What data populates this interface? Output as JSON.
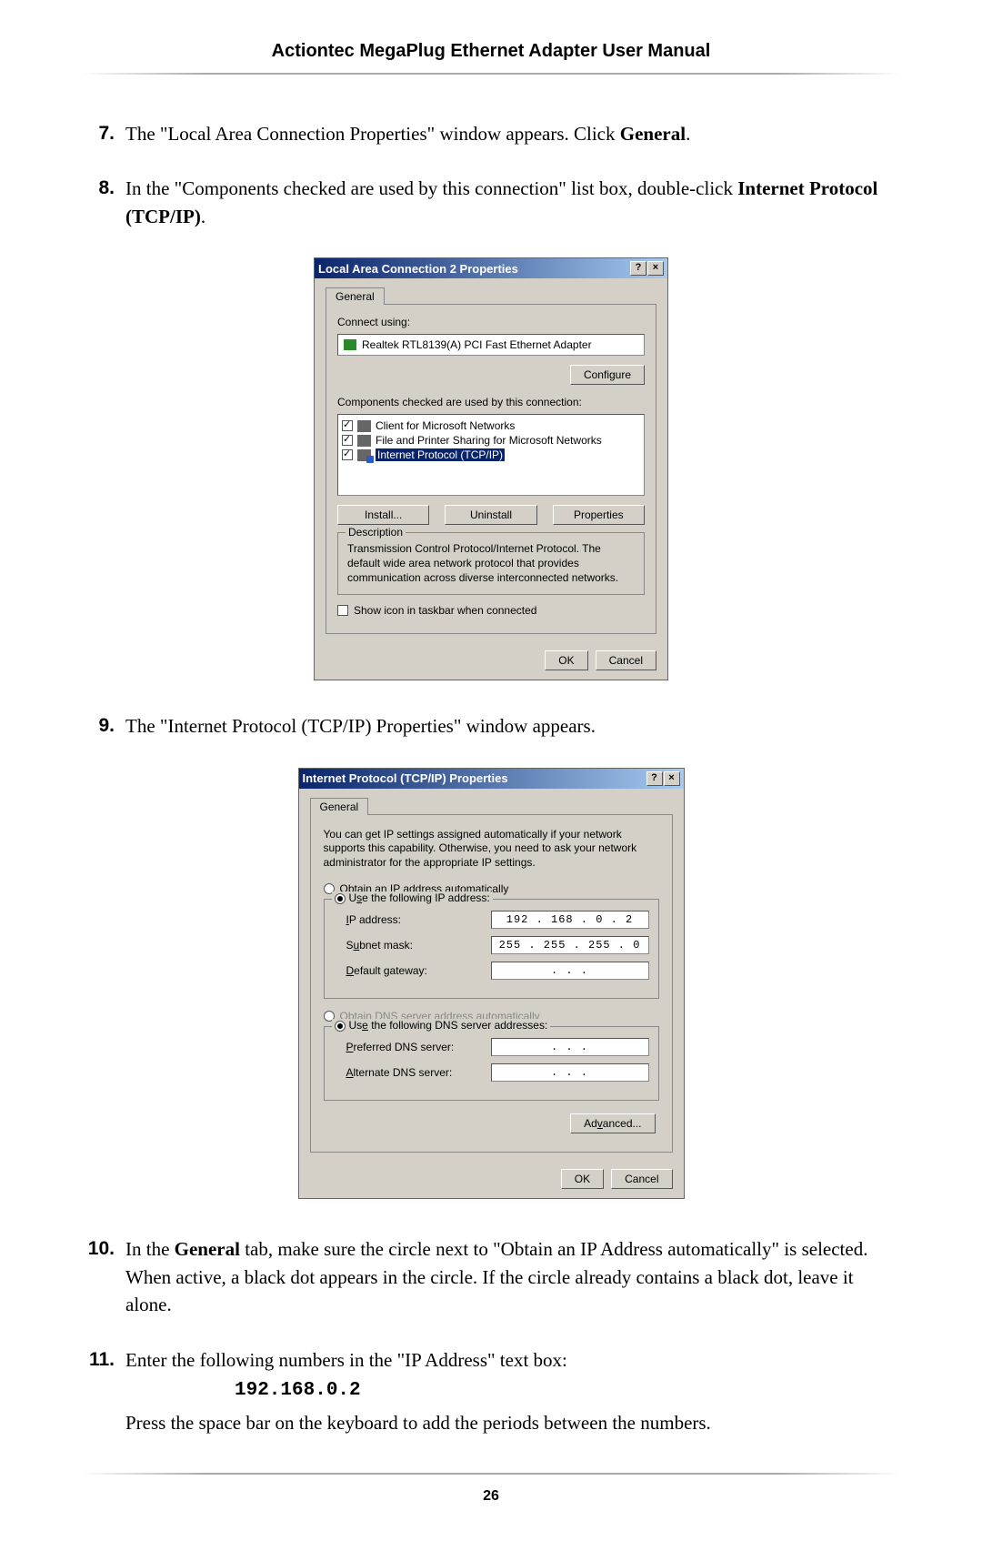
{
  "header": {
    "title": "Actiontec MegaPlug Ethernet Adapter User Manual"
  },
  "page_number": "26",
  "steps": {
    "s7_num": "7.",
    "s7_a": "The \"Local Area Connection Properties\" window appears. Click ",
    "s7_b": "General",
    "s7_c": ".",
    "s8_num": "8.",
    "s8_a": "In the \"Components checked are used by this connection\" list box, double-click ",
    "s8_b": "Internet Protocol (TCP/IP)",
    "s8_c": ".",
    "s9_num": "9.",
    "s9": "The \"Internet Protocol (TCP/IP) Properties\" window appears.",
    "s10_num": "10.",
    "s10_a": "In the ",
    "s10_b": "General",
    "s10_c": " tab, make sure the circle next to \"Obtain an IP Address automatically\" is selected. When active, a black dot appears in the circle.  If the circle already contains a black dot, leave it alone.",
    "s11_num": "11.",
    "s11_a": "Enter the following numbers in the \"IP Address\" text box:",
    "s11_code": "192.168.0.2",
    "s11_b": "Press the space bar on the keyboard to add the periods between the numbers."
  },
  "dlg1": {
    "title": "Local Area Connection 2 Properties",
    "tab": "General",
    "connect_using": "Connect using:",
    "adapter": "Realtek RTL8139(A) PCI Fast Ethernet Adapter",
    "configure": "Configure",
    "components_label": "Components checked are used by this connection:",
    "item1": "Client for Microsoft Networks",
    "item2": "File and Printer Sharing for Microsoft Networks",
    "item3": "Internet Protocol (TCP/IP)",
    "install": "Install...",
    "uninstall": "Uninstall",
    "properties": "Properties",
    "desc_legend": "Description",
    "desc": "Transmission Control Protocol/Internet Protocol. The default wide area network protocol that provides communication across diverse interconnected networks.",
    "show_icon": "Show icon in taskbar when connected",
    "ok": "OK",
    "cancel": "Cancel",
    "help": "?",
    "close": "×"
  },
  "dlg2": {
    "title": "Internet Protocol (TCP/IP) Properties",
    "tab": "General",
    "info": "You can get IP settings assigned automatically if your network supports this capability. Otherwise, you need to ask your network administrator for the appropriate IP settings.",
    "r1": "Obtain an IP address automatically",
    "r2": "Use the following IP address:",
    "ip_lbl": "IP address:",
    "ip_val": "192 . 168 .  0  .  2",
    "sm_lbl": "Subnet mask:",
    "sm_val": "255 . 255 . 255 .  0",
    "gw_lbl": "Default gateway:",
    "gw_val": " .       .       . ",
    "r3": "Obtain DNS server address automatically",
    "r4": "Use the following DNS server addresses:",
    "pdns_lbl": "Preferred DNS server:",
    "pdns_val": " .       .       . ",
    "adns_lbl": "Alternate DNS server:",
    "adns_val": " .       .       . ",
    "advanced": "Advanced...",
    "ok": "OK",
    "cancel": "Cancel",
    "help": "?",
    "close": "×"
  }
}
